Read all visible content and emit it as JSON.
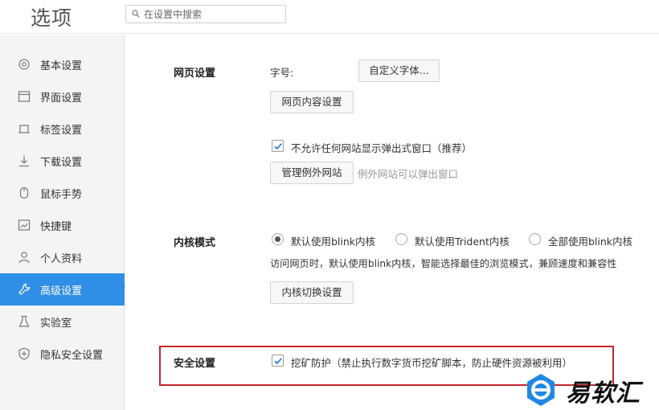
{
  "header": {
    "title": "选项",
    "search_placeholder": "在设置中搜索"
  },
  "sidebar": {
    "items": [
      {
        "label": "基本设置",
        "icon": "settings-icon"
      },
      {
        "label": "界面设置",
        "icon": "window-icon"
      },
      {
        "label": "标签设置",
        "icon": "tab-icon"
      },
      {
        "label": "下载设置",
        "icon": "download-icon"
      },
      {
        "label": "鼠标手势",
        "icon": "mouse-icon"
      },
      {
        "label": "快捷键",
        "icon": "keyboard-icon"
      },
      {
        "label": "个人资料",
        "icon": "user-icon"
      },
      {
        "label": "高级设置",
        "icon": "wrench-icon",
        "active": true
      },
      {
        "label": "实验室",
        "icon": "flask-icon"
      },
      {
        "label": "隐私安全设置",
        "icon": "shield-icon"
      }
    ],
    "active_color": "#2f8ee5"
  },
  "web_settings": {
    "title": "网页设置",
    "font_size_label": "字号:",
    "custom_font_button": "自定义字体...",
    "content_settings_button": "网页内容设置",
    "popup_block_label": "不允许任何网站显示弹出式窗口（推荐）",
    "popup_block_checked": true,
    "manage_exceptions_button": "管理例外网站",
    "exceptions_hint": "例外网站可以弹出窗口"
  },
  "kernel_mode": {
    "title": "内核模式",
    "options": [
      {
        "label": "默认使用blink内核",
        "selected": true
      },
      {
        "label": "默认使用Trident内核",
        "selected": false
      },
      {
        "label": "全部使用blink内核",
        "selected": false
      }
    ],
    "description": "访问网页时，默认使用blink内核，智能选择最佳的浏览模式，兼顾速度和兼容性",
    "switch_button": "内核切换设置"
  },
  "security": {
    "title": "安全设置",
    "mining_protection_label": "挖矿防护（禁止执行数字货币挖矿脚本，防止硬件资源被利用）",
    "mining_protection_checked": true,
    "highlight_color": "#c4262b"
  },
  "watermark": {
    "text": "易软汇",
    "logo_color": "#1e88e5"
  }
}
